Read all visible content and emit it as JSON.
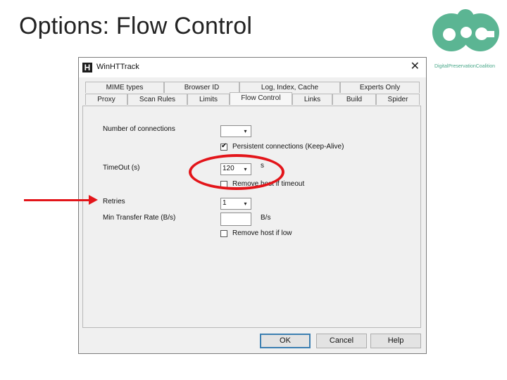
{
  "slide": {
    "title": "Options: Flow Control"
  },
  "logo": {
    "mark_text": "dpc",
    "caption": "DigitalPreservationCoalition",
    "color": "#5bb593"
  },
  "window": {
    "icon_letter": "H",
    "title": "WinHTTrack",
    "close_glyph": "✕"
  },
  "tabs": {
    "row1": [
      "MIME types",
      "Browser ID",
      "Log, Index, Cache",
      "Experts Only"
    ],
    "row2": [
      "Proxy",
      "Scan Rules",
      "Limits",
      "Flow Control",
      "Links",
      "Build",
      "Spider"
    ],
    "active": "Flow Control"
  },
  "form": {
    "connections_label": "Number of connections",
    "connections_value": "",
    "persistent_label": "Persistent connections (Keep-Alive)",
    "persistent_checked": true,
    "timeout_label": "TimeOut (s)",
    "timeout_value": "120",
    "timeout_unit": "s",
    "remove_host_timeout_label": "Remove host if timeout",
    "remove_host_timeout_checked": false,
    "retries_label": "Retries",
    "retries_value": "1",
    "min_rate_label": "Min Transfer Rate (B/s)",
    "min_rate_value": "",
    "min_rate_unit": "B/s",
    "remove_host_low_label": "Remove host if low",
    "remove_host_low_checked": false
  },
  "buttons": {
    "ok": "OK",
    "cancel": "Cancel",
    "help": "Help"
  },
  "glyphs": {
    "dropdown": "▾",
    "check": "✔"
  },
  "colors": {
    "annotation": "#e3151a",
    "window_bg": "#f0f0f0",
    "default_button_border": "#3c7fb1"
  }
}
